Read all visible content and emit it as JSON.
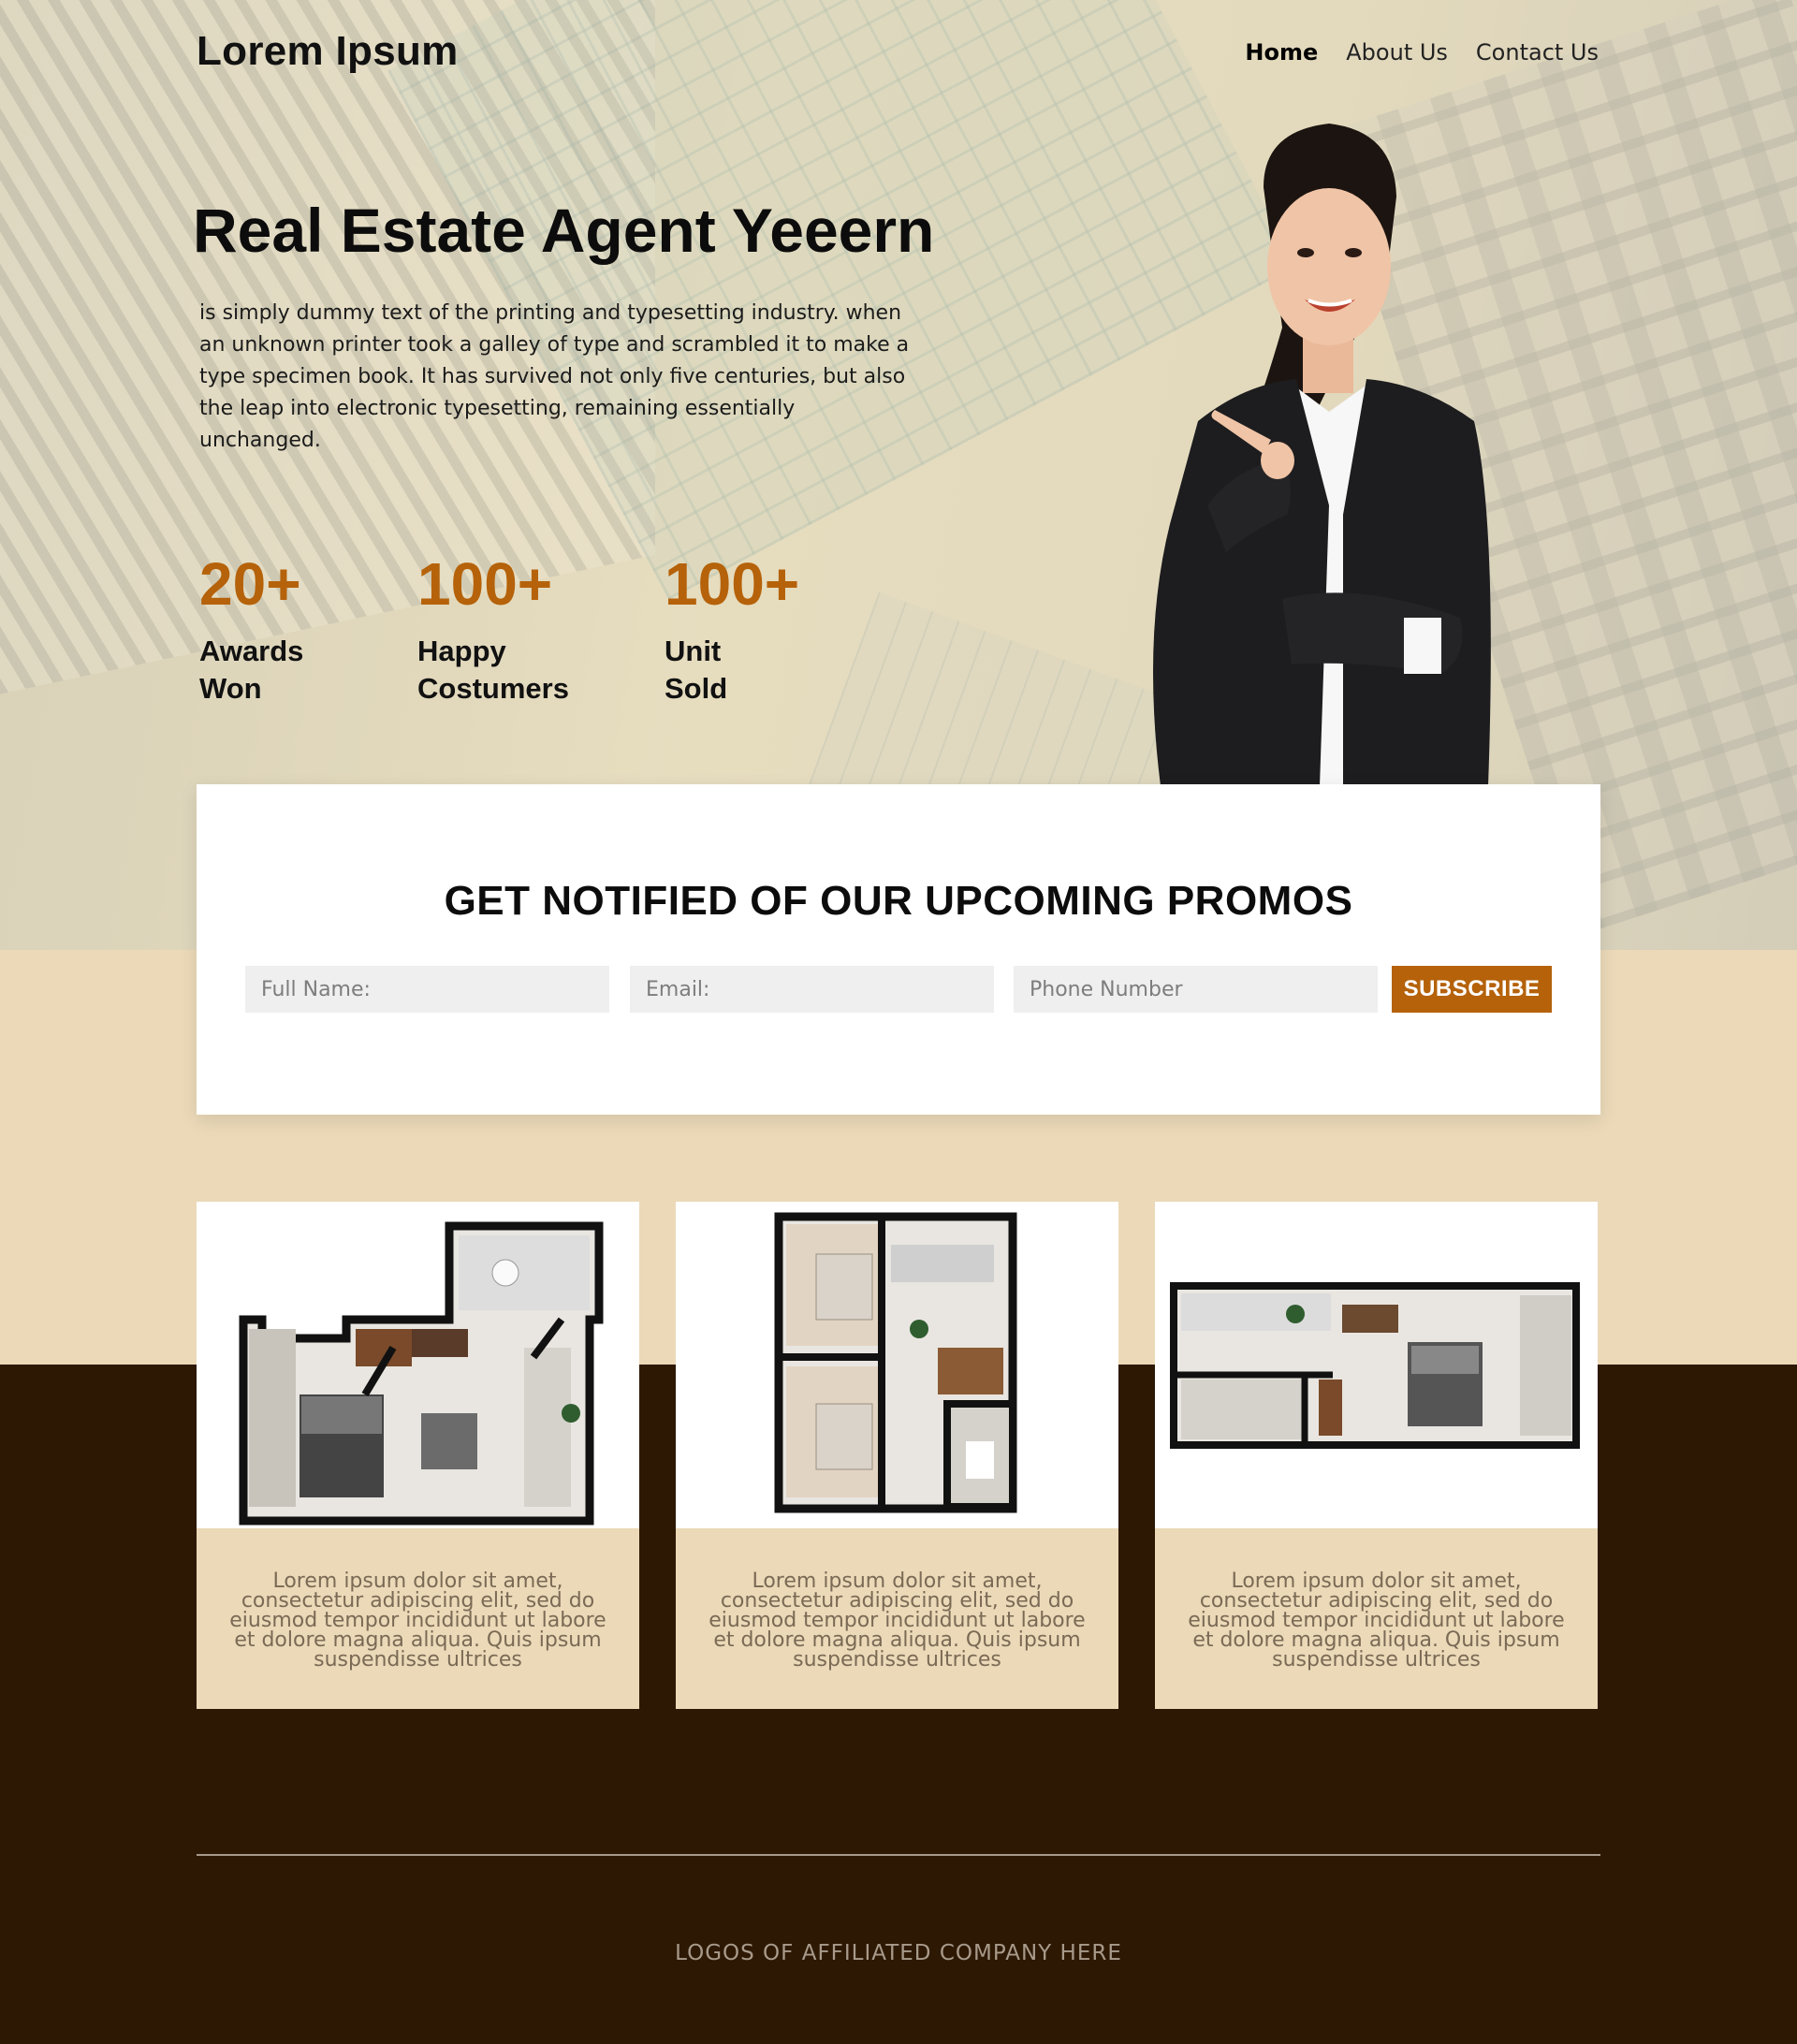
{
  "header": {
    "logo": "Lorem Ipsum",
    "nav": [
      "Home",
      "About Us",
      "Contact Us"
    ]
  },
  "hero": {
    "title": "Real Estate Agent Yeeern",
    "text": "is simply dummy text of the printing and typesetting industry. when an unknown printer took a galley of type and scrambled it to make a type specimen book. It has survived not only five centuries, but also the leap into electronic typesetting, remaining essentially unchanged.",
    "stats": [
      {
        "value": "20+",
        "label_line1": "Awards",
        "label_line2": "Won"
      },
      {
        "value": "100+",
        "label_line1": "Happy",
        "label_line2": "Costumers"
      },
      {
        "value": "100+",
        "label_line1": "Unit",
        "label_line2": "Sold"
      }
    ]
  },
  "promo": {
    "title": "GET NOTIFIED OF OUR UPCOMING PROMOS",
    "fields": {
      "name_placeholder": "Full Name:",
      "email_placeholder": "Email:",
      "phone_placeholder": "Phone Number"
    },
    "subscribe_label": "SUBSCRIBE"
  },
  "listings": [
    {
      "text": "Lorem ipsum dolor sit amet, consectetur adipiscing elit, sed do eiusmod tempor incididunt ut labore et dolore magna aliqua. Quis ipsum suspendisse ultrices"
    },
    {
      "text": "Lorem ipsum dolor sit amet, consectetur adipiscing elit, sed do eiusmod tempor incididunt ut labore et dolore magna aliqua. Quis ipsum suspendisse ultrices"
    },
    {
      "text": "Lorem ipsum dolor sit amet, consectetur adipiscing elit, sed do eiusmod tempor incididunt ut labore et dolore magna aliqua. Quis ipsum suspendisse ultrices"
    }
  ],
  "footer": {
    "logos_text": "LOGOS OF AFFILIATED COMPANY HERE"
  },
  "colors": {
    "accent": "#b5620a",
    "cream": "#ebd9b8",
    "dark_brown": "#2d1803"
  },
  "icons": [
    "floor-plan-image",
    "agent-photo"
  ]
}
